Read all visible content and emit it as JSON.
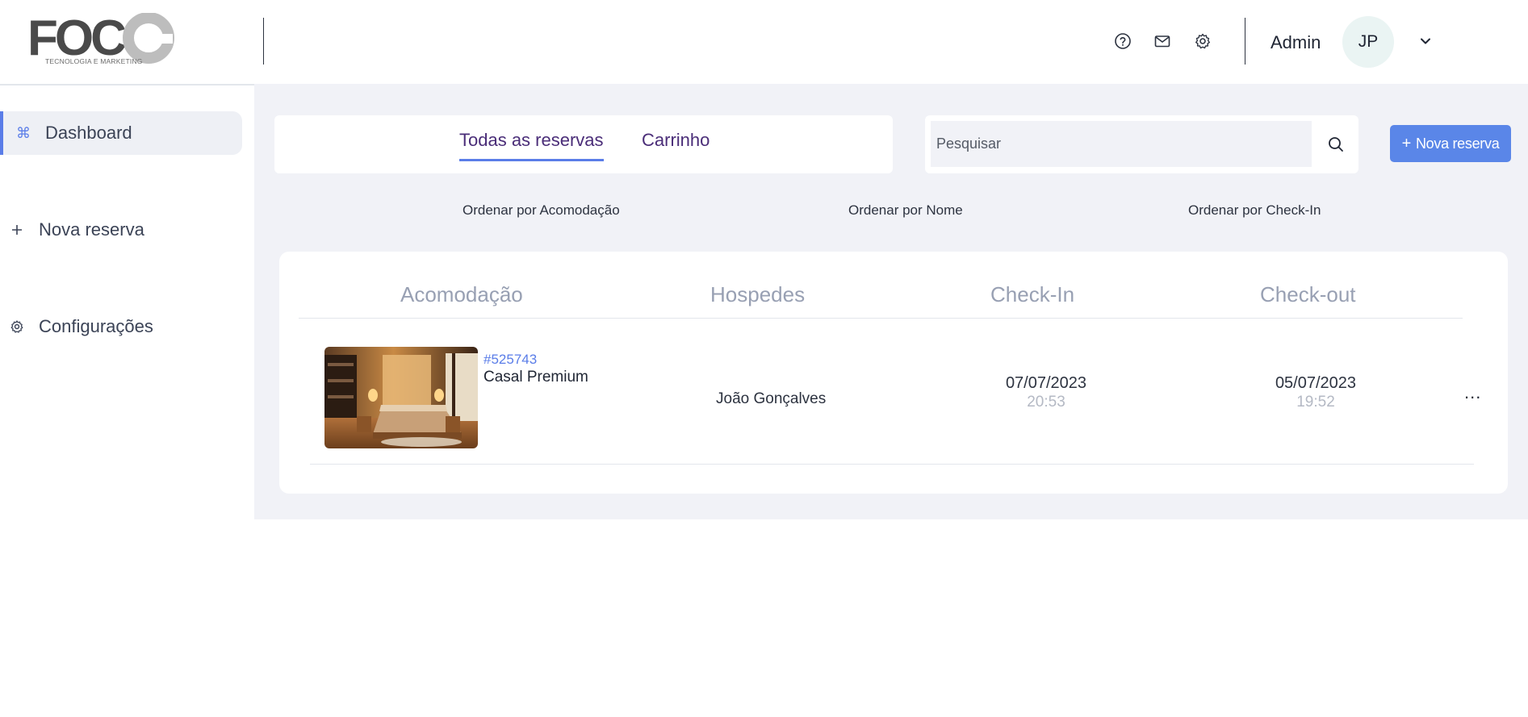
{
  "header": {
    "logo_text": "FOCO",
    "logo_subtitle": "TECNOLOGIA E MARKETING",
    "admin_label": "Admin",
    "avatar_initials": "JP",
    "icons": [
      "help-icon",
      "mail-icon",
      "gear-icon",
      "chevron-down-icon"
    ]
  },
  "sidebar": {
    "items": [
      {
        "label": "Dashboard",
        "icon": "command-icon",
        "active": true
      },
      {
        "label": "Nova reserva",
        "icon": "plus-icon",
        "active": false
      },
      {
        "label": "Configurações",
        "icon": "gear-icon",
        "active": false
      }
    ]
  },
  "main": {
    "tabs": [
      {
        "label": "Todas as reservas",
        "active": true
      },
      {
        "label": "Carrinho",
        "active": false
      }
    ],
    "search": {
      "placeholder": "Pesquisar"
    },
    "new_button_label": "Nova reserva",
    "sort": [
      "Ordenar por Acomodação",
      "Ordenar por Nome",
      "Ordenar por Check-In"
    ],
    "table": {
      "headers": [
        "Acomodação",
        "Hospedes",
        "Check-In",
        "Check-out"
      ],
      "rows": [
        {
          "code": "#525743",
          "room": "Casal Premium",
          "guest": "João Gonçalves",
          "checkin_date": "07/07/2023",
          "checkin_time": "20:53",
          "checkout_date": "05/07/2023",
          "checkout_time": "19:52",
          "actions": "..."
        }
      ]
    }
  },
  "colors": {
    "accent": "#5a7de8",
    "button": "#5a86e8",
    "tab_text": "#4a2d78",
    "background": "#f1f2f7"
  }
}
